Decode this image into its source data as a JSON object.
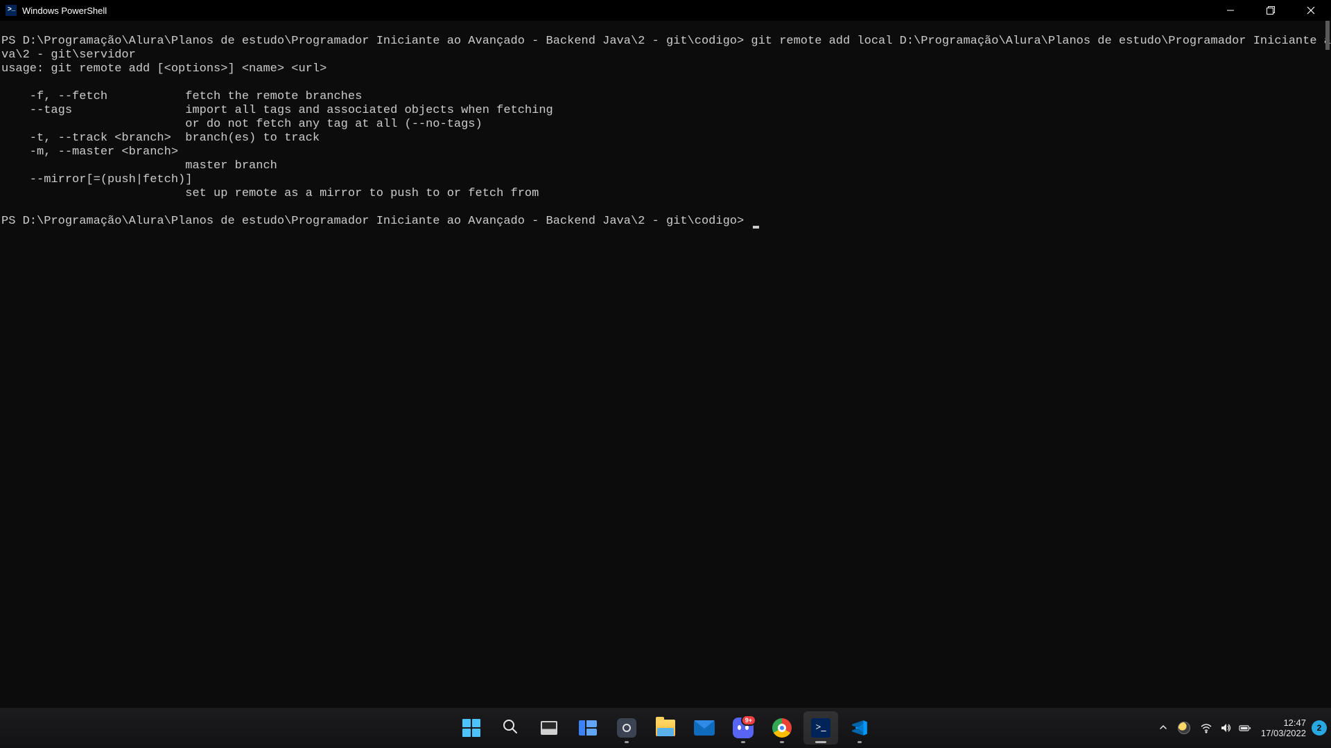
{
  "window": {
    "title": "Windows PowerShell"
  },
  "terminal": {
    "line1_prompt": "PS D:\\Programação\\Alura\\Planos de estudo\\Programador Iniciante ao Avançado - Backend Java\\2 - git\\codigo> ",
    "line1_cmd": "git remote add local D:\\Programação\\Alura\\Planos de estudo\\Programador Iniciante ao Avançado - Backend Ja",
    "line2": "va\\2 - git\\servidor",
    "line3": "usage: git remote add [<options>] <name> <url>",
    "line4": "",
    "line5": "    -f, --fetch           fetch the remote branches",
    "line6": "    --tags                import all tags and associated objects when fetching",
    "line7": "                          or do not fetch any tag at all (--no-tags)",
    "line8": "    -t, --track <branch>  branch(es) to track",
    "line9": "    -m, --master <branch>",
    "line10": "                          master branch",
    "line11": "    --mirror[=(push|fetch)]",
    "line12": "                          set up remote as a mirror to push to or fetch from",
    "line13": "",
    "line14_prompt": "PS D:\\Programação\\Alura\\Planos de estudo\\Programador Iniciante ao Avançado - Backend Java\\2 - git\\codigo> "
  },
  "taskbar": {
    "discord_badge": "9+",
    "time": "12:47",
    "date": "17/03/2022",
    "notification_count": "2"
  }
}
